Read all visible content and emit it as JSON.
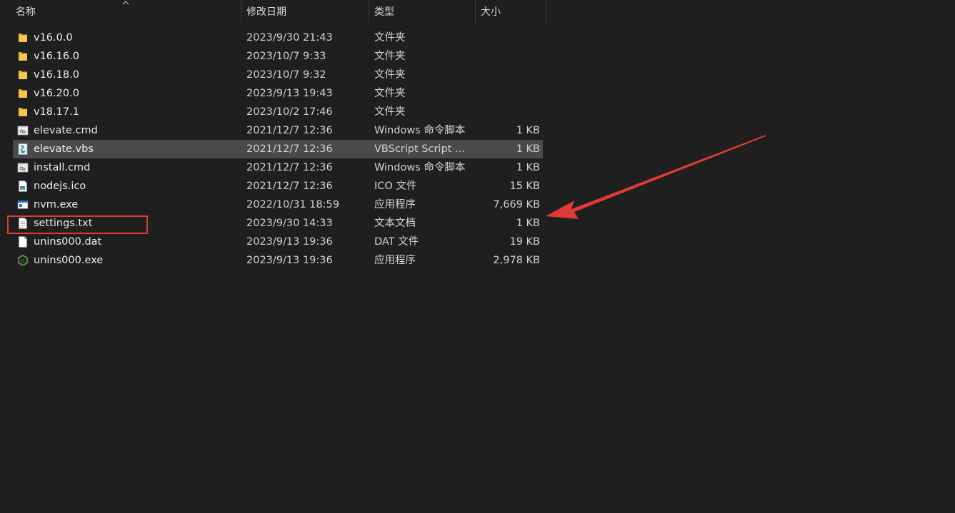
{
  "columns": {
    "name": "名称",
    "date": "修改日期",
    "type": "类型",
    "size": "大小"
  },
  "files": [
    {
      "name": "v16.0.0",
      "date": "2023/9/30 21:43",
      "type": "文件夹",
      "size": "",
      "icon": "folder-icon"
    },
    {
      "name": "v16.16.0",
      "date": "2023/10/7 9:33",
      "type": "文件夹",
      "size": "",
      "icon": "folder-icon"
    },
    {
      "name": "v16.18.0",
      "date": "2023/10/7 9:32",
      "type": "文件夹",
      "size": "",
      "icon": "folder-icon"
    },
    {
      "name": "v16.20.0",
      "date": "2023/9/13 19:43",
      "type": "文件夹",
      "size": "",
      "icon": "folder-icon"
    },
    {
      "name": "v18.17.1",
      "date": "2023/10/2 17:46",
      "type": "文件夹",
      "size": "",
      "icon": "folder-icon"
    },
    {
      "name": "elevate.cmd",
      "date": "2021/12/7 12:36",
      "type": "Windows 命令脚本",
      "size": "1 KB",
      "icon": "cmd-script-icon"
    },
    {
      "name": "elevate.vbs",
      "date": "2021/12/7 12:36",
      "type": "VBScript Script ...",
      "size": "1 KB",
      "icon": "vbscript-icon"
    },
    {
      "name": "install.cmd",
      "date": "2021/12/7 12:36",
      "type": "Windows 命令脚本",
      "size": "1 KB",
      "icon": "cmd-script-icon"
    },
    {
      "name": "nodejs.ico",
      "date": "2021/12/7 12:36",
      "type": "ICO 文件",
      "size": "15 KB",
      "icon": "image-file-icon"
    },
    {
      "name": "nvm.exe",
      "date": "2022/10/31 18:59",
      "type": "应用程序",
      "size": "7,669 KB",
      "icon": "application-icon"
    },
    {
      "name": "settings.txt",
      "date": "2023/9/30 14:33",
      "type": "文本文档",
      "size": "1 KB",
      "icon": "text-file-icon"
    },
    {
      "name": "unins000.dat",
      "date": "2023/9/13 19:36",
      "type": "DAT 文件",
      "size": "19 KB",
      "icon": "blank-file-icon"
    },
    {
      "name": "unins000.exe",
      "date": "2023/9/13 19:36",
      "type": "应用程序",
      "size": "2,978 KB",
      "icon": "installer-icon"
    }
  ],
  "selected_file": "elevate.vbs",
  "highlighted_file": "settings.txt",
  "colors": {
    "background": "#1f1f1f",
    "selected_row": "#4a4a4a",
    "annotation": "#e03a35",
    "folder": "#f6c74b"
  }
}
